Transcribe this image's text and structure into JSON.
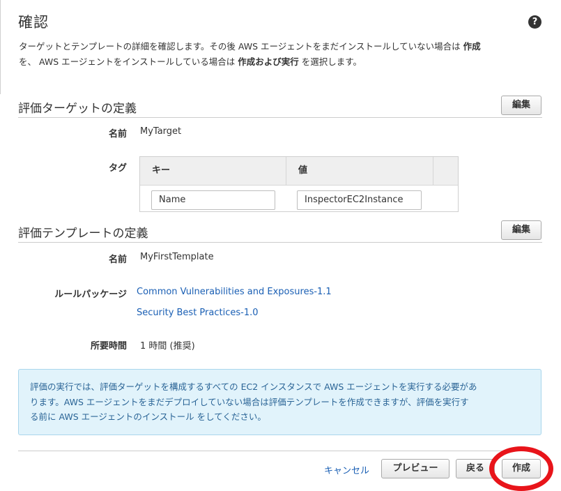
{
  "page": {
    "title": "確認"
  },
  "intro": {
    "line1_prefix": "ターゲットとテンプレートの詳細を確認します。その後 AWS エージェントをまだインストールしていない場合は ",
    "line1_bold": "作成",
    "line2_prefix": "を、 AWS エージェントをインストールしている場合は ",
    "line2_bold": "作成および実行",
    "line2_suffix": " を選択します。"
  },
  "target_section": {
    "title": "評価ターゲットの定義",
    "edit_label": "編集",
    "name_label": "名前",
    "name_value": "MyTarget",
    "tag_label": "タグ",
    "tag_table": {
      "key_header": "キー",
      "value_header": "値",
      "rows": [
        {
          "key": "Name",
          "value": "InspectorEC2Instance"
        }
      ]
    }
  },
  "template_section": {
    "title": "評価テンプレートの定義",
    "edit_label": "編集",
    "name_label": "名前",
    "name_value": "MyFirstTemplate",
    "rules_label": "ルールパッケージ",
    "rules": [
      "Common Vulnerabilities and Exposures-1.1",
      "Security Best Practices-1.0"
    ],
    "duration_label": "所要時間",
    "duration_value": "1 時間 (推奨)"
  },
  "info": {
    "line1": "評価の実行では、評価ターゲットを構成するすべての EC2 インスタンスで AWS エージェントを実行する必要があ",
    "line2": "ります。AWS エージェントをまだデプロイしていない場合は評価テンプレートを作成できますが、評価を実行す",
    "line3": "る前に AWS エージェントのインストール をしてください。"
  },
  "footer": {
    "cancel_label": "キャンセル",
    "preview_label": "プレビュー",
    "back_label": "戻る",
    "create_label": "作成"
  },
  "colors": {
    "link": "#1a5fb4",
    "info_bg": "#e1f3fb",
    "highlight": "#e8141a"
  }
}
